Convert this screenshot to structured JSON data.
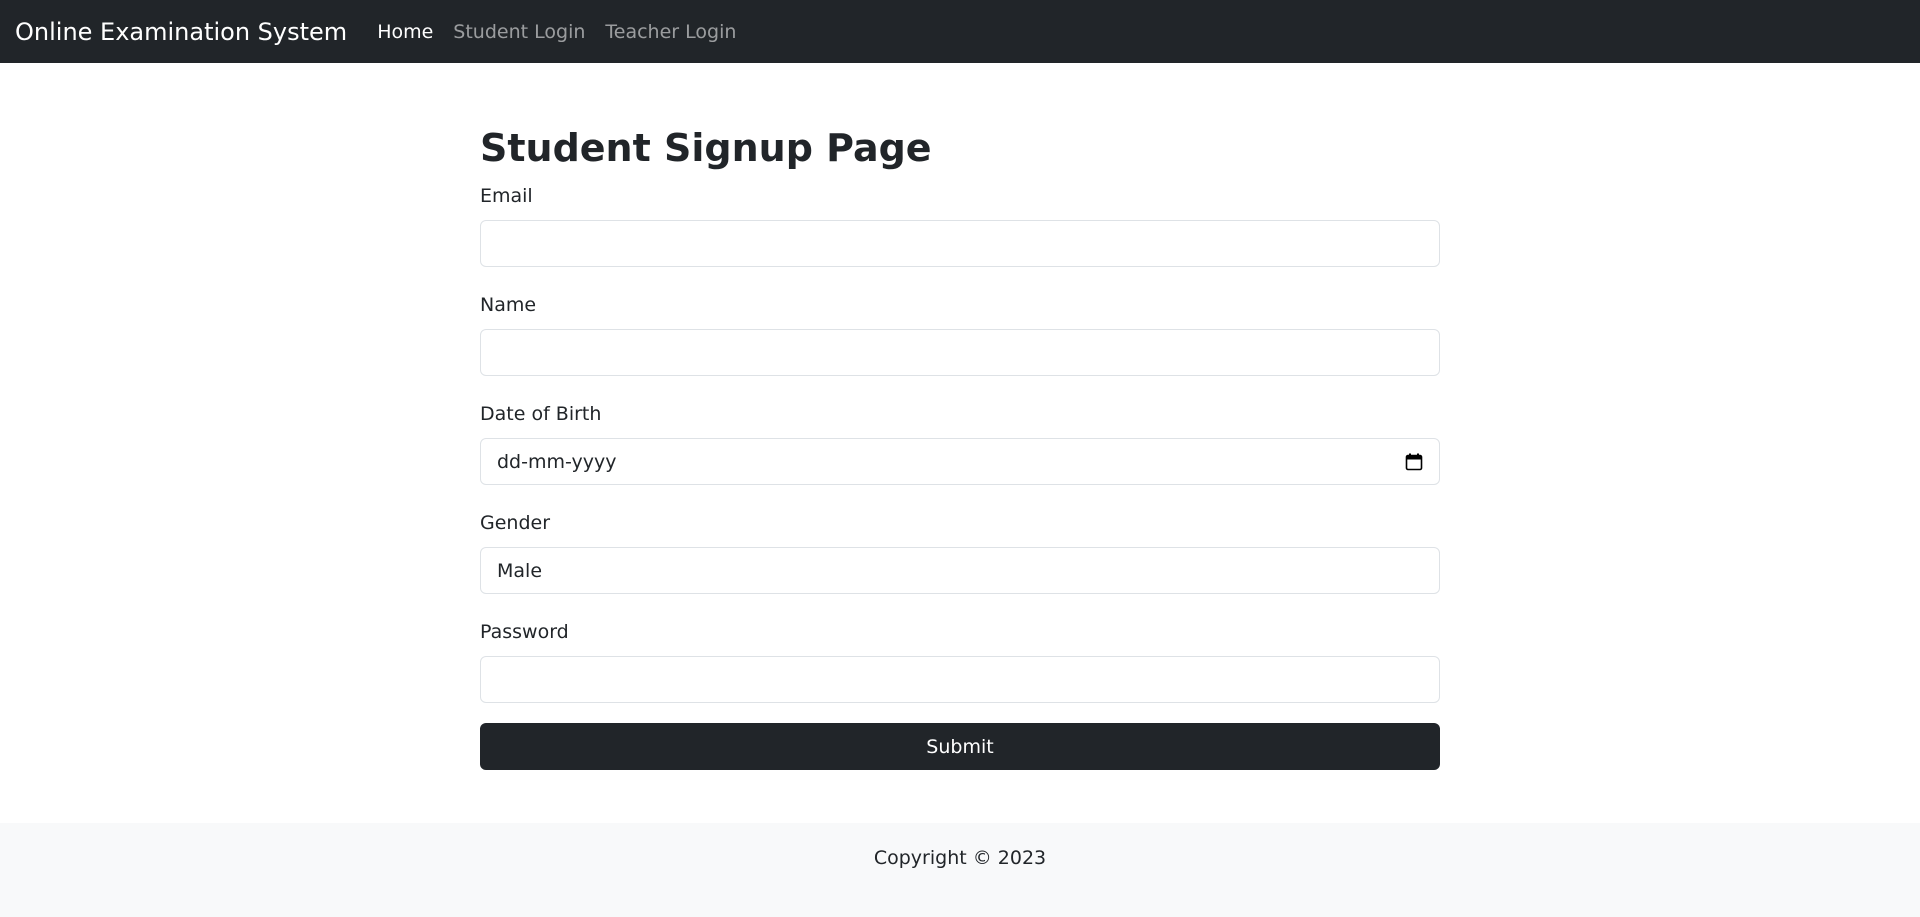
{
  "navbar": {
    "brand": "Online Examination System",
    "links": [
      {
        "label": "Home"
      },
      {
        "label": "Student Login"
      },
      {
        "label": "Teacher Login"
      }
    ]
  },
  "form": {
    "title": "Student Signup Page",
    "email_label": "Email",
    "email_value": "",
    "name_label": "Name",
    "name_value": "",
    "dob_label": "Date of Birth",
    "dob_placeholder": "dd-mm-yyyy",
    "gender_label": "Gender",
    "gender_value": "Male",
    "password_label": "Password",
    "password_value": "",
    "submit_label": "Submit"
  },
  "footer": {
    "copyright": "Copyright © 2023"
  },
  "colors": {
    "navbar_bg": "#212529",
    "button_bg": "#212529",
    "footer_bg": "#f8f9fa"
  },
  "icons": {
    "dob_picker": "calendar-icon"
  }
}
